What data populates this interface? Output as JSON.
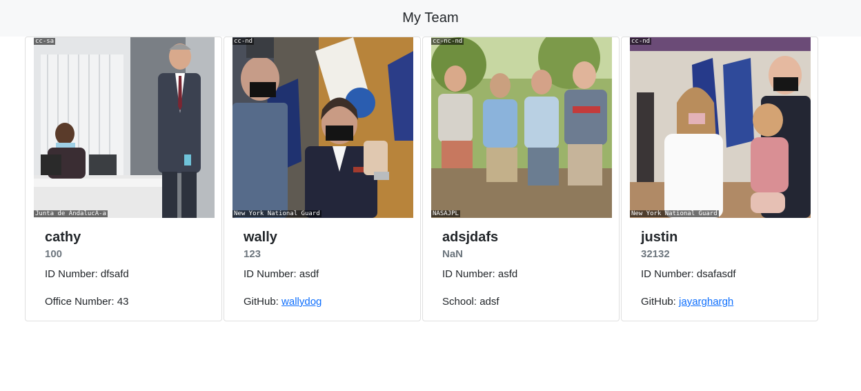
{
  "navbar": {
    "title": "My Team"
  },
  "cards": [
    {
      "name": "cathy",
      "number": "100",
      "id_label": "ID Number: dfsafd",
      "extra_label": "Office Number: 43",
      "extra_link": "",
      "license": "cc-sa",
      "credit": "Junta de AndalucA-a"
    },
    {
      "name": "wally",
      "number": "123",
      "id_label": "ID Number: asdf",
      "extra_label": "GitHub: ",
      "extra_link": "wallydog",
      "license": "cc-nd",
      "credit": "New York National Guard"
    },
    {
      "name": "adsjdafs",
      "number": "NaN",
      "id_label": "ID Number: asfd",
      "extra_label": "School: adsf",
      "extra_link": "",
      "license": "cc-nc-nd",
      "credit": "NASAJPL"
    },
    {
      "name": "justin",
      "number": "32132",
      "id_label": "ID Number: dsafasdf",
      "extra_label": "GitHub: ",
      "extra_link": "jayarghargh",
      "license": "cc-nd",
      "credit": "New York National Guard"
    }
  ]
}
